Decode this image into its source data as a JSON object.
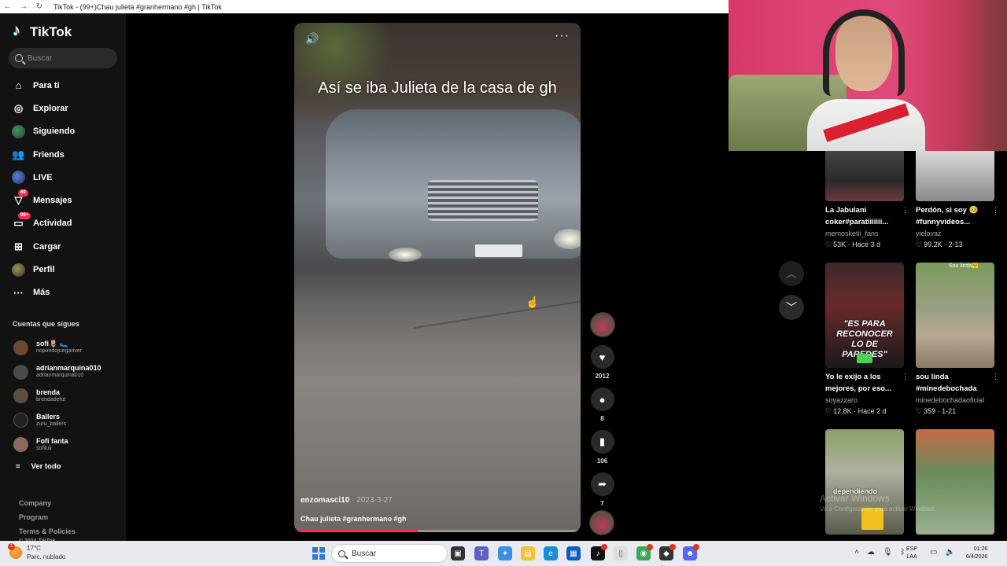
{
  "browser": {
    "tab_title": "TikTok - (99+)Chau julieta #granhermano #gh | TikTok"
  },
  "sidebar": {
    "logo_text": "TikTok",
    "search_placeholder": "Buscar",
    "nav": [
      {
        "label": "Para ti",
        "icon": "home-icon"
      },
      {
        "label": "Explorar",
        "icon": "compass-icon"
      },
      {
        "label": "Siguiendo",
        "icon": "following-avatar-icon"
      },
      {
        "label": "Friends",
        "icon": "friends-icon"
      },
      {
        "label": "LIVE",
        "icon": "live-avatar-icon"
      },
      {
        "label": "Mensajes",
        "icon": "messages-icon",
        "badge": "69"
      },
      {
        "label": "Actividad",
        "icon": "activity-icon",
        "badge": "99+"
      },
      {
        "label": "Cargar",
        "icon": "upload-icon"
      },
      {
        "label": "Perfil",
        "icon": "profile-avatar-icon"
      },
      {
        "label": "Más",
        "icon": "more-icon"
      }
    ],
    "following_title": "Cuentas que sigues",
    "following": [
      {
        "name": "sofi🌷 🥿",
        "user": "nopuedojuegariver"
      },
      {
        "name": "adrianmarquina010",
        "user": "adrianmarquina010"
      },
      {
        "name": "brenda",
        "user": "brendadefut"
      },
      {
        "name": "Ballers",
        "user": "zuru_ballers"
      },
      {
        "name": "Fofi fanta",
        "user": "sofiluii"
      }
    ],
    "see_all": "Ver todo",
    "footer": [
      "Company",
      "Program",
      "Terms & Policies"
    ],
    "copyright": "© 2024 TikTok"
  },
  "video": {
    "overlay_text": "Así se iba Julieta de la casa de gh",
    "author": "enzomasci10",
    "date": " · 2023-3-27",
    "description": "Chau julieta #granhermano #gh",
    "progress_percent": 43,
    "likes": "2012",
    "comments": "8",
    "saves": "106",
    "shares": "7"
  },
  "recommendations": [
    {
      "title": "La Jabulani coker#paratiiiiiii...",
      "user": "memosketii_fans",
      "likes": "53K",
      "date": "Hace 3 d"
    },
    {
      "title": "Perdón, si soy 🥺 #funnyvideos...",
      "user": "yielovaz",
      "likes": "99.2K",
      "date": "2-13"
    },
    {
      "title": "Yo le exijo a los mejores, por eso...",
      "user": "soyazzaro",
      "likes": "12.8K",
      "date": "Hace 2 d",
      "thumb_text": "\"ES PARA RECONOCER LO DE PAREDES\""
    },
    {
      "title": "sou linda #minedebochada",
      "user": "minedebochadaoficial",
      "likes": "359",
      "date": "1-21",
      "thumb_text": "Sou linda🤗"
    },
    {
      "thumb_text": "dependiendo"
    },
    {}
  ],
  "watermark": {
    "title": "Activar Windows",
    "subtitle": "Ve a Configuración para activar Windows."
  },
  "taskbar": {
    "temperature": "17°C",
    "weather": "Parc. nublado",
    "weather_badge": "1",
    "search_placeholder": "Buscar",
    "lang_line1": "ESP",
    "lang_line2": "LAA",
    "time": "01:26",
    "date": "6/4/2026"
  }
}
